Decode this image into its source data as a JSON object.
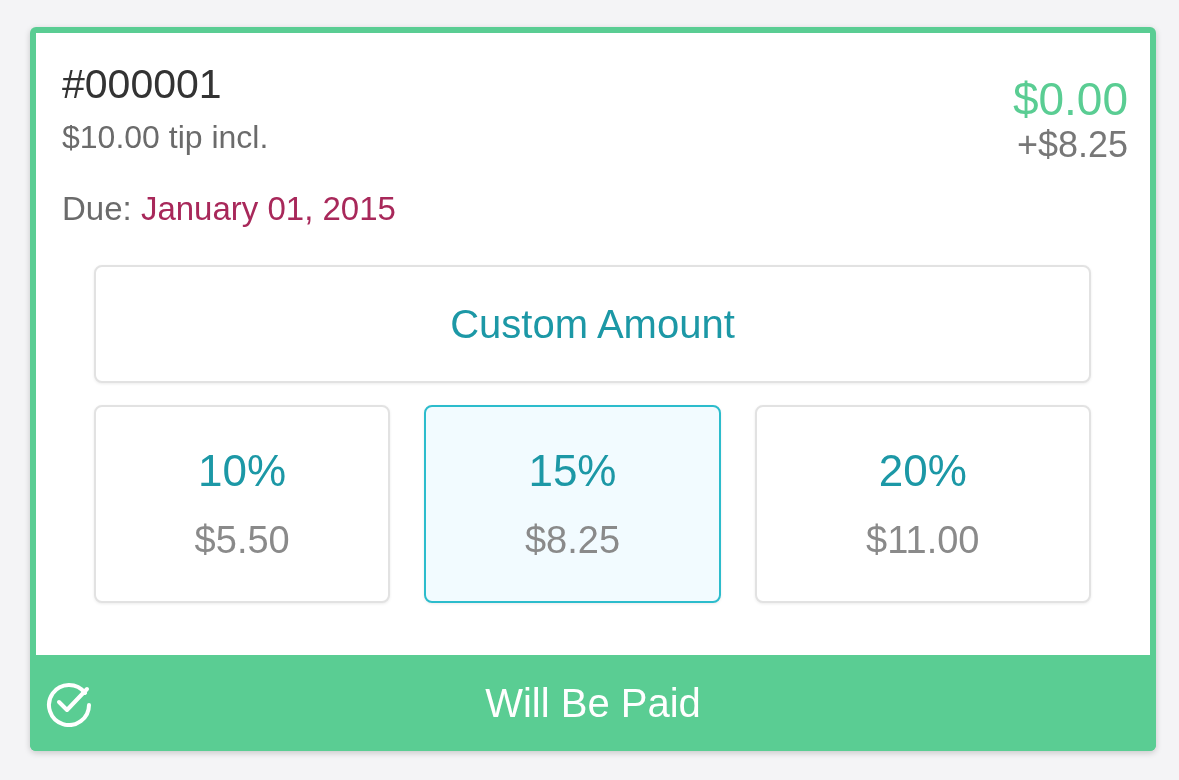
{
  "invoice": {
    "number": "#000001",
    "tip_note": "$10.00 tip incl.",
    "due_label": "Due:",
    "due_date": "January 01, 2015",
    "amount": "$0.00",
    "tip_added": "+$8.25"
  },
  "custom_button": {
    "label": "Custom Amount"
  },
  "tip_options": [
    {
      "percent": "10%",
      "amount": "$5.50",
      "selected": false
    },
    {
      "percent": "15%",
      "amount": "$8.25",
      "selected": true
    },
    {
      "percent": "20%",
      "amount": "$11.00",
      "selected": false
    }
  ],
  "status_bar": {
    "label": "Will Be Paid"
  }
}
